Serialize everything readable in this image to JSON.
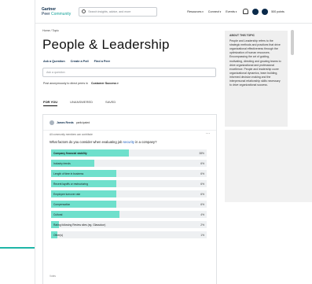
{
  "header": {
    "logo_line1": "Gartner",
    "logo_line2_a": "Peer ",
    "logo_line2_b": "Community",
    "search_placeholder": "Search insights, advice, and more",
    "nav": [
      "Resources",
      "Connect",
      "Events"
    ],
    "points": "500 points"
  },
  "breadcrumb": "Home / Topic",
  "title": "People & Leadership",
  "actions": [
    "Ask a Question",
    "Create a Poll",
    "Find a Peer"
  ],
  "ask_placeholder": "Ask a question",
  "post_row": {
    "text": "Post anonymously to direct peers in",
    "segment": "Customer Success"
  },
  "tabs": [
    "FOR YOU",
    "UNANSWERED",
    "SAVED"
  ],
  "card": {
    "author_name": "James Reeds",
    "author_action": "participated",
    "members_text": "All community members can contribute",
    "question_prefix": "What factors do you consider when evaluating job ",
    "question_keyword": "security",
    "question_suffix": " in a company?",
    "votes_label": "Votes"
  },
  "poll": [
    {
      "label": "Company financial stability",
      "pct": "38%",
      "value": 38,
      "bold": true
    },
    {
      "label": "Industry trends",
      "pct": "6%",
      "value": 6
    },
    {
      "label": "Length of time in business",
      "pct": "6%",
      "value": 6
    },
    {
      "label": "Recent layoffs or restructuring",
      "pct": "6%",
      "value": 6
    },
    {
      "label": "Employee turnover rate",
      "pct": "6%",
      "value": 6
    },
    {
      "label": "Compensation",
      "pct": "6%",
      "value": 6
    },
    {
      "label": "Cultural",
      "pct": "4%",
      "value": 4
    },
    {
      "label": "Rating following Review sites (eg. Glassdoor)",
      "pct": "2%",
      "value": 2
    },
    {
      "label": "Other(s)",
      "pct": "1%",
      "value": 1
    }
  ],
  "sidebar": {
    "heading": "ABOUT THIS TOPIC",
    "text": "People and Leadership refers to the strategic methods and practices that drive organizational effectiveness through the optimization of human resources. Encompassing the art of guiding, motivating, directing and growing teams to drive organizational and professional excellence. People and leadership cover organizational dynamics, team building, informed decision making and the interpersonal relationship skills necessary to drive organizational success."
  },
  "colors": {
    "accent": "#6fe0cc",
    "brand_navy": "#0a2a4a",
    "teal": "#16a39a"
  }
}
